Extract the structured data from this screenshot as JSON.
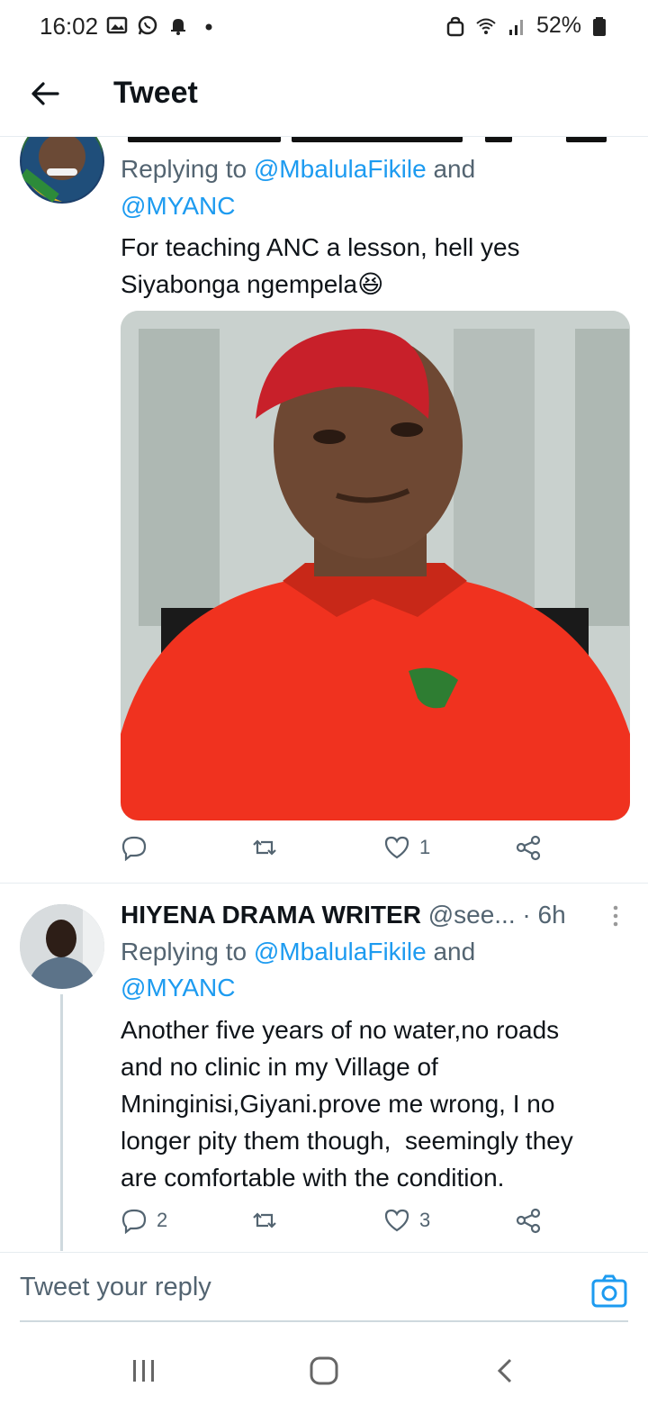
{
  "status_bar": {
    "time": "16:02",
    "battery": "52%",
    "left_icons": [
      "gallery-icon",
      "whatsapp-icon",
      "notification-bell-icon",
      "dot-icon"
    ],
    "right_icons": [
      "lock-icon",
      "wifi-icon",
      "signal-icon",
      "battery-icon"
    ]
  },
  "header": {
    "title": "Tweet",
    "back_icon": "arrow-left-icon"
  },
  "tweet1": {
    "replying_prefix": "Replying to ",
    "mention1": "@MbalulaFikile",
    "and_text": " and",
    "mention2": "@MYANC",
    "text_line1": "For teaching ANC a lesson, hell yes",
    "text_line2": "Siyabonga ngempela",
    "emoji": "😆",
    "likes": "1",
    "replies": "",
    "retweets": ""
  },
  "tweet2": {
    "name": "HIYENA DRAMA WRITER",
    "handle": "@see...",
    "time": "· 6h",
    "replying_prefix": "Replying to ",
    "mention1": "@MbalulaFikile",
    "and_text": " and",
    "mention2": "@MYANC",
    "text_lines": [
      "Another five years of no water,no roads",
      "and no clinic in my Village of",
      "Mninginisi,Giyani.prove me wrong, I no",
      "longer pity them though,  seemingly they",
      "are comfortable with the condition."
    ],
    "replies": "2",
    "retweets": "",
    "likes": "3"
  },
  "reply_bar": {
    "placeholder": "Tweet your reply"
  },
  "colors": {
    "accent": "#1d9bf0",
    "secondary_text": "#536471",
    "primary_text": "#0f1419",
    "beret_red": "#c8202a",
    "shirt_red": "#f0321f"
  }
}
